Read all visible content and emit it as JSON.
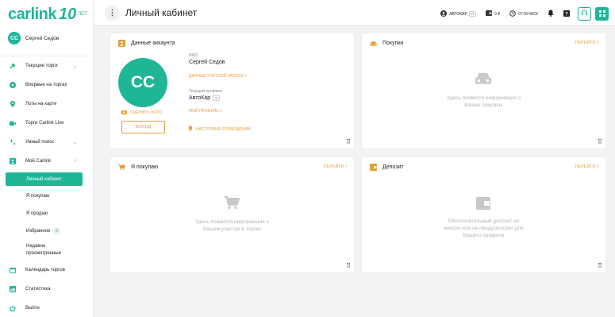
{
  "sidebar": {
    "logo_text": "carlink",
    "logo_number": "10",
    "logo_years": "ЛЕТ",
    "user": {
      "initials": "СС",
      "name": "Сергей Седов"
    },
    "items": [
      {
        "label": "Текущие торги",
        "icon": "gavel-icon"
      },
      {
        "label": "Впервые на торгах",
        "icon": "star-icon"
      },
      {
        "label": "Лоты на карте",
        "icon": "map-pin-icon"
      },
      {
        "label": "Торги Carlink Live",
        "icon": "video-icon"
      },
      {
        "label": "Умный поиск",
        "icon": "sparkle-icon"
      },
      {
        "label": "Мой Carlink",
        "icon": "person-icon"
      }
    ],
    "sub_items": [
      {
        "label": "Личный кабинет"
      },
      {
        "label": "Я покупаю"
      },
      {
        "label": "Я продаю"
      },
      {
        "label": "Избранное",
        "badge": "0"
      },
      {
        "label": "Недавно просмотренные"
      }
    ],
    "bottom_items": [
      {
        "label": "Календарь торгов",
        "icon": "calendar-icon"
      },
      {
        "label": "Статистика",
        "icon": "stats-icon"
      },
      {
        "label": "Выйти",
        "icon": "power-icon"
      }
    ]
  },
  "header": {
    "title": "Личный кабинет",
    "profile": "АВТОКАР",
    "profile_badge": "Я",
    "balance": "0 ₽",
    "time": "07:59 МСК"
  },
  "account_card": {
    "title": "Данные аккаунта",
    "initials": "СС",
    "change_photo": "СМЕНИТЬ ФОТО",
    "logout": "ВЫХОД",
    "fio_label": "ФИО",
    "fio_value": "Сергей Седов",
    "account_link": "ДАННЫЕ УЧЁТНОЙ ЗАПИСИ >",
    "profile_label": "Текущий профиль",
    "profile_value": "АвтоКар",
    "profile_badge": "Я",
    "my_profile_link": "МОЙ ПРОФИЛЬ >",
    "notif_link": "НАСТРОЙКА ОПОВЕЩЕНИЙ"
  },
  "purchases_card": {
    "title": "Покупки",
    "link": "ПЕРЕЙТИ >",
    "empty_line1": "Здесь появится информация о",
    "empty_line2": "Ваших покупках"
  },
  "buying_card": {
    "title": "Я покупаю",
    "link": "ПЕРЕЙТИ >",
    "empty_line1": "Здесь появится информация о",
    "empty_line2": "Вашем участии в торгах"
  },
  "deposit_card": {
    "title": "Депозит",
    "link": "ПЕРЕЙТИ >",
    "empty_line1": "Обеспечительный депозит не",
    "empty_line2": "внесен или не предусмотрен для",
    "empty_line3": "Вашего профиля"
  },
  "colors": {
    "accent": "#1fb597",
    "link": "#e0a03a"
  }
}
